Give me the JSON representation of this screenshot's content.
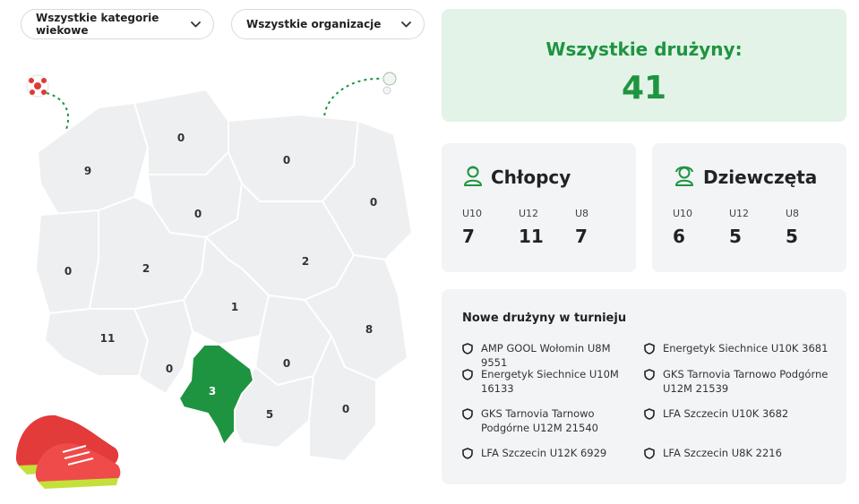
{
  "filters": {
    "age_category": "Wszystkie kategorie wiekowe",
    "organization": "Wszystkie organizacje"
  },
  "map": {
    "highlight_color": "#1e9440",
    "region_color": "#eeeff1",
    "border_color": "#ffffff",
    "regions": [
      {
        "id": "zachodniopomorskie",
        "count": "9"
      },
      {
        "id": "pomorskie",
        "count": "0"
      },
      {
        "id": "warminsko-mazurskie",
        "count": "0"
      },
      {
        "id": "kujawsko-pomorskie",
        "count": "0"
      },
      {
        "id": "podlaskie",
        "count": "0"
      },
      {
        "id": "lubuskie",
        "count": "0"
      },
      {
        "id": "wielkopolskie",
        "count": "2"
      },
      {
        "id": "mazowieckie",
        "count": "2"
      },
      {
        "id": "lodzkie",
        "count": "1"
      },
      {
        "id": "dolnoslaskie",
        "count": "11"
      },
      {
        "id": "lubelskie",
        "count": "8"
      },
      {
        "id": "opolskie",
        "count": "0"
      },
      {
        "id": "slaskie",
        "count": "3",
        "highlighted": true
      },
      {
        "id": "swietokrzyskie",
        "count": "0"
      },
      {
        "id": "malopolskie",
        "count": "5"
      },
      {
        "id": "podkarpackie",
        "count": "0"
      }
    ]
  },
  "total": {
    "title": "Wszystkie drużyny:",
    "value": "41"
  },
  "boys": {
    "title": "Chłopcy",
    "icon": "boy-avatar-icon",
    "categories": [
      {
        "label": "U10",
        "value": "7"
      },
      {
        "label": "U12",
        "value": "11"
      },
      {
        "label": "U8",
        "value": "7"
      }
    ]
  },
  "girls": {
    "title": "Dziewczęta",
    "icon": "girl-avatar-icon",
    "categories": [
      {
        "label": "U10",
        "value": "6"
      },
      {
        "label": "U12",
        "value": "5"
      },
      {
        "label": "U8",
        "value": "5"
      }
    ]
  },
  "new_teams": {
    "title": "Nowe drużyny w turnieju",
    "icon": "shield-icon",
    "items": [
      "AMP GOOL Wołomin U8M 9551",
      "Energetyk Siechnice U10K 3681",
      "Energetyk Siechnice U10M 16133",
      "GKS Tarnovia Tarnowo Podgórne U12M 21539",
      "GKS Tarnovia Tarnowo Podgórne U12M 21540",
      "LFA Szczecin U10K 3682",
      "LFA Szczecin U12K 6929",
      "LFA Szczecin U8K 2216"
    ]
  },
  "colors": {
    "accent": "#1e9440",
    "total_card_bg": "#e3f3e7",
    "card_bg": "#f3f4f5"
  }
}
